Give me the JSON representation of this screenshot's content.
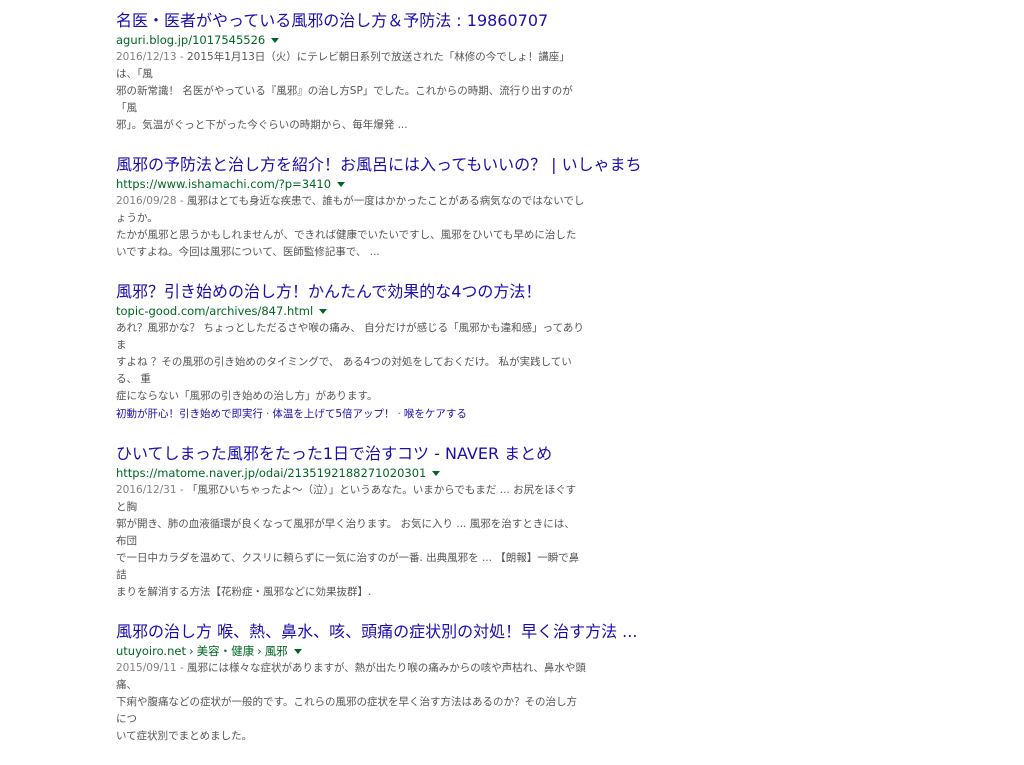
{
  "results": [
    {
      "title": "名医・医者がやっている風邪の治し方＆予防法 : 19860707",
      "url": "aguri.blog.jp/1017545526",
      "date": "2016/12/13 - ",
      "lines": [
        "2015年1月13日（火）にテレビ朝日系列で放送された「林修の今でしょ！講座」は、「風",
        "邪の新常識！ 名医がやっている『風邪』の治し方SP」でした。これからの時期、流行り出すのが「風",
        "邪」。気温がぐっと下がった今ぐらいの時期から、毎年爆発 ..."
      ]
    },
    {
      "title": "風邪の予防法と治し方を紹介！お風呂には入ってもいいの？ | いしゃまち",
      "url": "https://www.ishamachi.com/?p=3410",
      "date": "2016/09/28 - ",
      "lines": [
        "風邪はとても身近な疾患で、誰もが一度はかかったことがある病気なのではないでしょうか。",
        "たかが風邪と思うかもしれませんが、できれば健康でいたいですし、風邪をひいても早めに治した",
        "いですよね。今回は風邪について、医師監修記事で、 ..."
      ]
    },
    {
      "title": "風邪？引き始めの治し方！かんたんで効果的な4つの方法！",
      "url": "topic-good.com/archives/847.html",
      "date": "",
      "lines": [
        "あれ？風邪かな？ ちょっとしただるさや喉の痛み、 自分だけが感じる「風邪かも違和感」ってありま",
        "すよね ？その風邪の引き始めのタイミングで、 ある4つの対処をしておくだけ。 私が実践している、 重",
        "症にならない「風邪の引き始めの治し方」があります。"
      ],
      "sitelinks": [
        "初動が肝心！引き始めで即実行",
        "体温を上げて5倍アップ！",
        "喉をケアする"
      ]
    },
    {
      "title": "ひいてしまった風邪をたった1日で治すコツ - NAVER まとめ",
      "url": "https://matome.naver.jp/odai/2135192188271020301",
      "date": "2016/12/31 - ",
      "lines": [
        "「風邪ひいちゃったよ〜（泣）」というあなた。いまからでもまだ ... お尻をほぐすと胸",
        "郭が開き、肺の血液循環が良くなって風邪が早く治ります。 お気に入り ... 風邪を治すときには、 布団",
        "で一日中カラダを温めて、クスリに頼らずに一気に治すのが一番. 出典風邪を ... 【朗報】一瞬で鼻詰",
        "まりを解消する方法【花粉症・風邪などに効果抜群】."
      ]
    },
    {
      "title": "風邪の治し方 喉、熱、鼻水、咳、頭痛の症状別の対処！早く治す方法 ...",
      "url_parts": [
        "utuyoiro.net",
        "美容・健康",
        "風邪"
      ],
      "date": "2015/09/11 - ",
      "lines": [
        "風邪には様々な症状がありますが、熱が出たり喉の痛みからの咳や声枯れ、鼻水や頭痛、",
        "下痢や腹痛などの症状が一般的です。これらの風邪の症状を早く治す方法はあるのか？その治し方につ",
        "いて症状別でまとめました。"
      ]
    }
  ]
}
